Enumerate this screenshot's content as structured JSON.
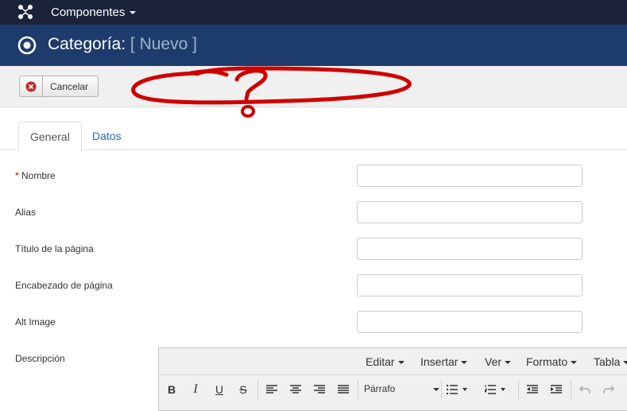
{
  "topbar": {
    "menu_label": "Componentes"
  },
  "header": {
    "title": "Categoría:",
    "subtitle": "[ Nuevo ]"
  },
  "toolbar": {
    "cancel_label": "Cancelar"
  },
  "tabs": [
    {
      "label": "General",
      "active": true
    },
    {
      "label": "Datos",
      "active": false
    }
  ],
  "form": {
    "fields": [
      {
        "label": "Nombre",
        "required": true,
        "value": ""
      },
      {
        "label": "Alias",
        "required": false,
        "value": ""
      },
      {
        "label": "Título de la página",
        "required": false,
        "value": ""
      },
      {
        "label": "Encabezado de página",
        "required": false,
        "value": ""
      },
      {
        "label": "Alt Image",
        "required": false,
        "value": ""
      }
    ],
    "description_label": "Descripción"
  },
  "editor": {
    "menus": [
      "Editar",
      "Insertar",
      "Ver",
      "Formato",
      "Tabla"
    ],
    "format_select": "Párrafo",
    "buttons": {
      "bold": "B",
      "italic": "I",
      "underline": "U",
      "strike": "S"
    }
  },
  "colors": {
    "topbar": "#1a2338",
    "titlebar": "#1d3c6b",
    "annotation": "#d10000",
    "link": "#2a69b8"
  }
}
